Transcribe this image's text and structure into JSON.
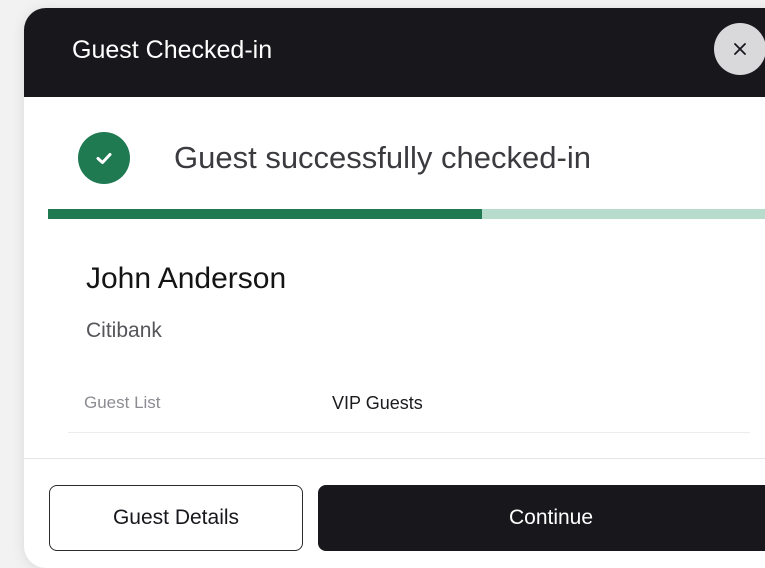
{
  "modal": {
    "title": "Guest Checked-in"
  },
  "status": {
    "message": "Guest successfully checked-in",
    "icon": "check-circle-icon",
    "color": "#1f7a52"
  },
  "progress": {
    "fraction": 0.59,
    "fill_color": "#1f7a52",
    "track_color": "#b8dccb"
  },
  "guest": {
    "name": "John Anderson",
    "company": "Citibank",
    "details": [
      {
        "label": "Guest List",
        "value": "VIP Guests"
      }
    ]
  },
  "actions": {
    "secondary_label": "Guest Details",
    "primary_label": "Continue"
  },
  "colors": {
    "header_bg": "#18171c",
    "primary_button_bg": "#18171c"
  }
}
